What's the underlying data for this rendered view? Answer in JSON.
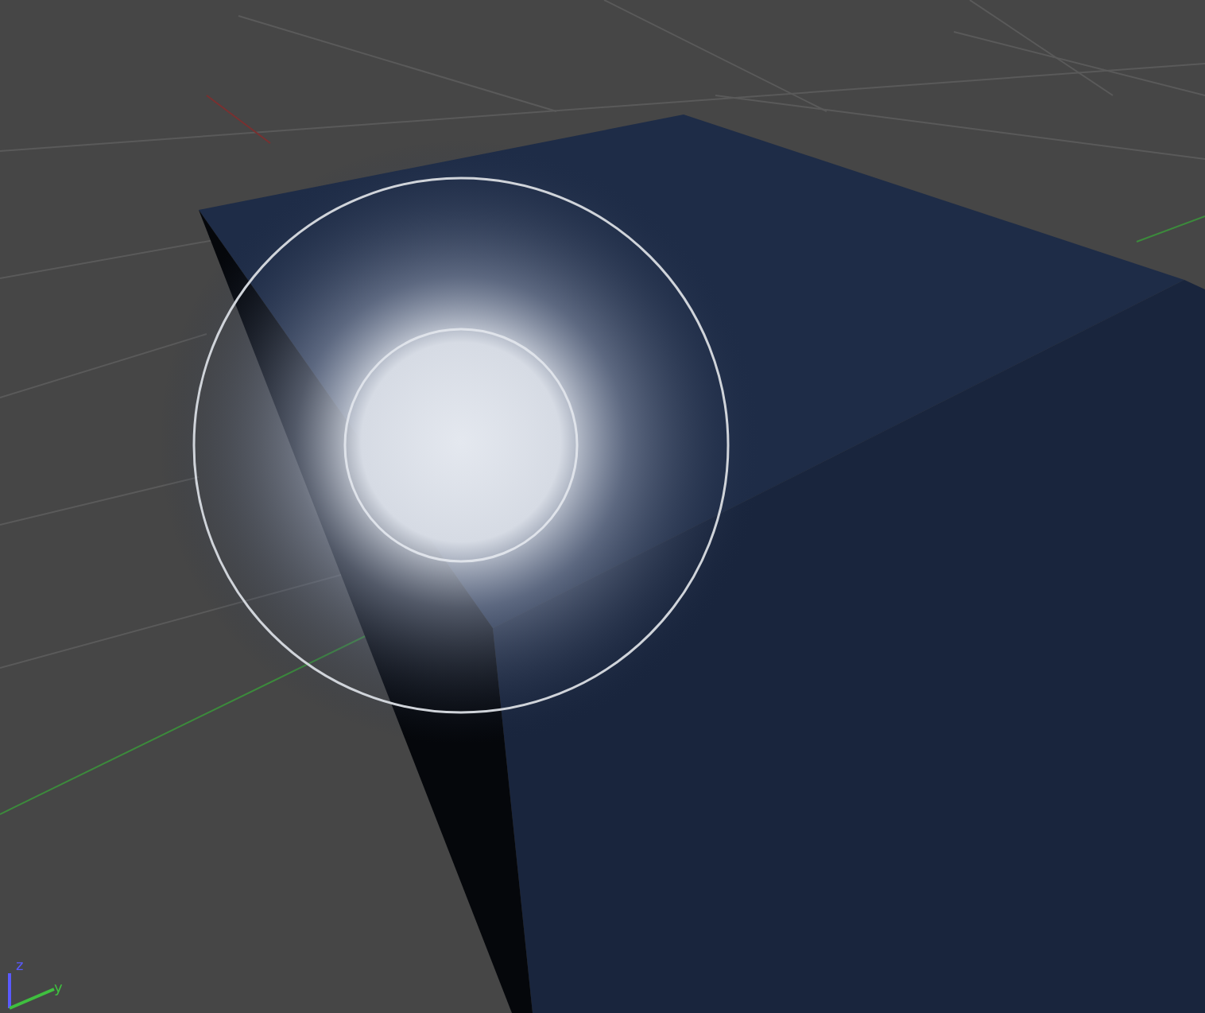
{
  "viewport": {
    "axis_gizmo": [
      {
        "label": "z",
        "color": "#5a5aff"
      },
      {
        "label": "y",
        "color": "#3fbf3f"
      }
    ]
  }
}
